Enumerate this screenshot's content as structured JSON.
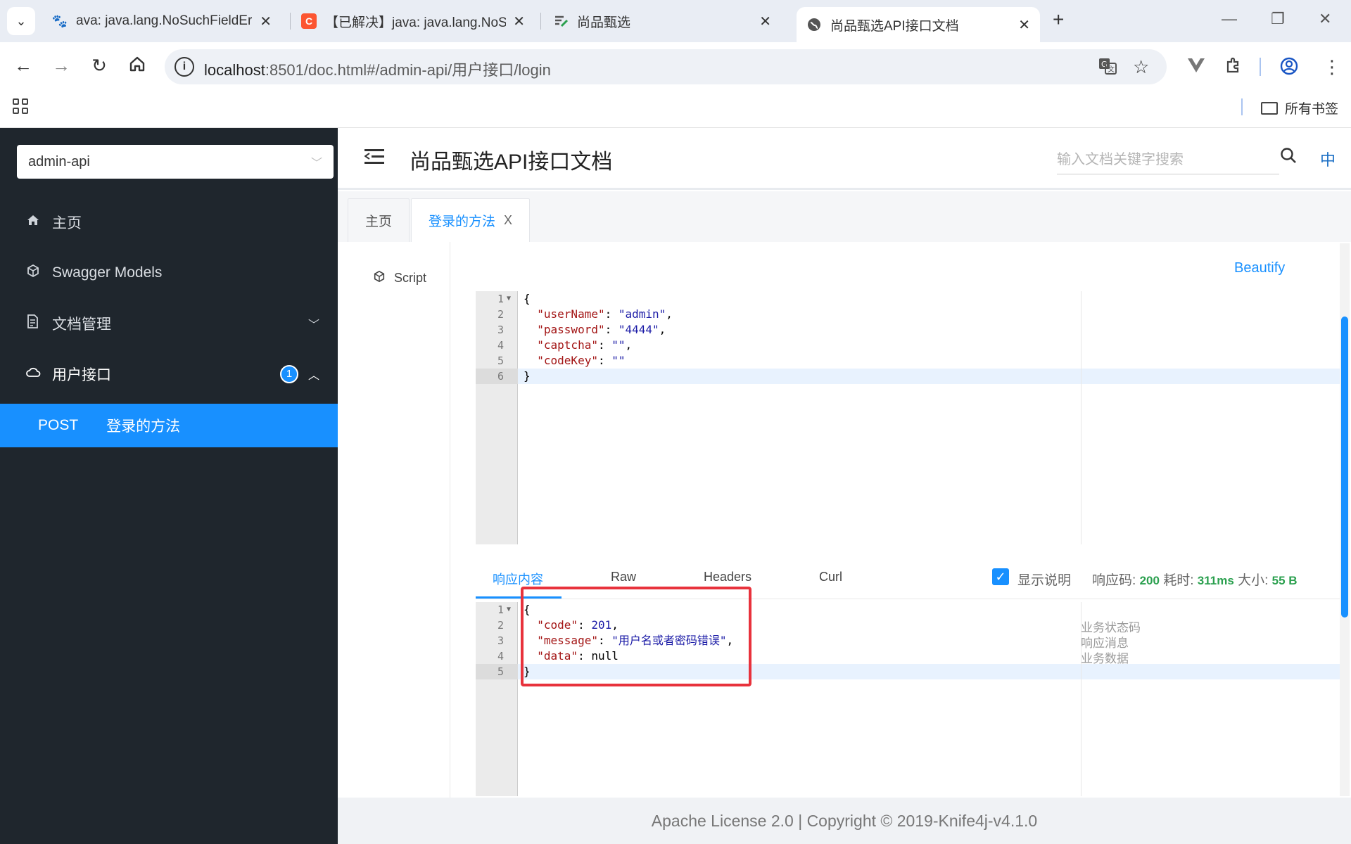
{
  "browser": {
    "tabs": [
      {
        "title": "ava: java.lang.NoSuchFieldError",
        "icon": "paw-icon"
      },
      {
        "title": "【已解决】java: java.lang.NoSuchFieldError",
        "icon": "csdn-icon",
        "icon_text": "C"
      },
      {
        "title": "尚品甄选",
        "icon": "doc-edit-icon"
      },
      {
        "title": "尚品甄选API接口文档",
        "icon": "globe-icon"
      }
    ],
    "url_host": "localhost",
    "url_rest": ":8501/doc.html#/admin-api/用户接口/login",
    "bookmarks_folder": "所有书签"
  },
  "sidebar": {
    "group_select": "admin-api",
    "items": [
      {
        "label": "主页",
        "icon": "home-icon"
      },
      {
        "label": "Swagger Models",
        "icon": "box-icon"
      },
      {
        "label": "文档管理",
        "icon": "doc-icon"
      },
      {
        "label": "用户接口",
        "icon": "cloud-icon",
        "badge": "1"
      }
    ],
    "subitem": {
      "method": "POST",
      "label": "登录的方法"
    }
  },
  "header": {
    "title": "尚品甄选API接口文档",
    "search_placeholder": "输入文档关键字搜索",
    "lang": "中"
  },
  "doc_tabs": [
    {
      "label": "主页"
    },
    {
      "label": "登录的方法",
      "close": "X"
    }
  ],
  "content": {
    "script_label": "Script",
    "beautify_label": "Beautify",
    "request_lines": [
      "{",
      "  \"userName\": \"admin\",",
      "  \"password\": \"4444\",",
      "  \"captcha\": \"\",",
      "  \"codeKey\": \"\"",
      "}"
    ],
    "response_tabs": [
      "响应内容",
      "Raw",
      "Headers",
      "Curl"
    ],
    "show_desc_label": "显示说明",
    "status_label": "响应码:",
    "status_value": "200",
    "time_label": "耗时:",
    "time_value": "311ms",
    "size_label": "大小:",
    "size_value": "55 B",
    "response_lines": [
      "{",
      "  \"code\": 201,",
      "  \"message\": \"用户名或者密码错误\",",
      "  \"data\": null",
      "}"
    ],
    "response_desc": [
      "业务状态码",
      "响应消息",
      "业务数据"
    ]
  },
  "footer": {
    "text": "Apache License 2.0 | Copyright © 2019-Knife4j-v4.1.0"
  },
  "colors": {
    "accent": "#1890ff",
    "sidebar_bg": "#1f262d",
    "highlight": "#e8323c",
    "ok": "#2ba04f"
  }
}
